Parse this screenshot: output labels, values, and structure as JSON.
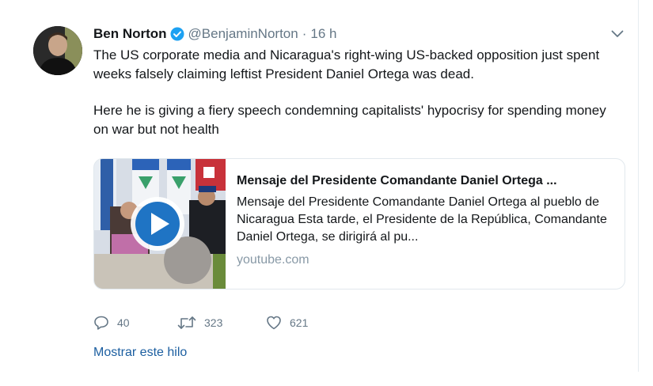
{
  "tweet": {
    "author_name": "Ben Norton",
    "handle": "@BenjaminNorton",
    "separator": "·",
    "time": "16 h",
    "text_paragraph_1": "The US corporate media and Nicaragua's right-wing US-backed opposition just spent weeks falsely claiming leftist President Daniel Ortega was dead.",
    "text_paragraph_2": "Here he is giving a fiery speech condemning capitalists' hypocrisy for spending money on war but not health"
  },
  "card": {
    "title": "Mensaje del Presidente Comandante Daniel Ortega ...",
    "description": "Mensaje del Presidente Comandante Daniel Ortega al pueblo de Nicaragua Esta tarde, el Presidente de la República, Comandante Daniel Ortega, se dirigirá al pu...",
    "domain": "youtube.com"
  },
  "actions": {
    "replies": "40",
    "retweets": "323",
    "likes": "621"
  },
  "show_thread_label": "Mostrar este hilo",
  "colors": {
    "verified_blue": "#1da1f2",
    "play_button_blue": "#1f74c4",
    "icon_gray": "#657786",
    "link_blue": "#1b5ea0"
  },
  "icons": {
    "verified": "verified-badge-icon",
    "caret": "chevron-down-icon",
    "play": "play-icon",
    "reply": "reply-icon",
    "retweet": "retweet-icon",
    "like": "heart-icon"
  }
}
